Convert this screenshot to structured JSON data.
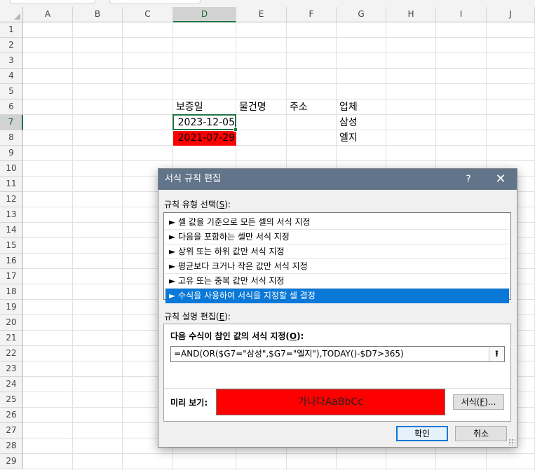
{
  "sheet": {
    "columns": [
      "A",
      "B",
      "C",
      "D",
      "E",
      "F",
      "G",
      "H",
      "I",
      "J"
    ],
    "rows": [
      "1",
      "2",
      "3",
      "4",
      "5",
      "6",
      "7",
      "8",
      "9",
      "10",
      "11",
      "12",
      "13",
      "14",
      "15",
      "16",
      "17",
      "18",
      "19",
      "20",
      "21",
      "22",
      "23",
      "24",
      "25",
      "26",
      "27",
      "28",
      "29"
    ],
    "selected_column": "D",
    "selected_row": "7",
    "cells": {
      "d6": "보증일",
      "e6": "물건명",
      "f6": "주소",
      "g6": "업체",
      "d7": "2023-12-05",
      "g7": "삼성",
      "d8": "2021-07-29",
      "g8": "엘지"
    },
    "highlight_color": "#ff0000",
    "accent_color": "#217346"
  },
  "dialog": {
    "title": "서식 규칙 편집",
    "help_glyph": "?",
    "close_glyph": "✕",
    "rule_type_label": "규칙 유형 선택(",
    "rule_type_key": "S",
    "rule_type_suffix": "):",
    "rule_types": [
      "► 셀 값을 기준으로 모든 셀의 서식 지정",
      "► 다음을 포함하는 셀만 서식 지정",
      "► 상위 또는 하위 값만 서식 지정",
      "► 평균보다 크거나 작은 값만 서식 지정",
      "► 고유 또는 중복 값만 서식 지정",
      "► 수식을 사용하여 서식을 지정할 셀 결정"
    ],
    "selected_rule_index": 5,
    "desc_label": "규칙 설명 편집(",
    "desc_key": "E",
    "desc_suffix": "):",
    "formula_label": "다음 수식이 참인 값의 서식 지정(",
    "formula_key": "O",
    "formula_suffix": "):",
    "formula_value": "=AND(OR($G7=\"삼성\",$G7=\"엘지\"),TODAY()-$D7>365)",
    "collapse_glyph": "⭱",
    "preview_label": "미리 보기:",
    "preview_text": "가나다AaBbCc",
    "preview_color": "#ff0000",
    "format_button_prefix": "서식(",
    "format_button_key": "F",
    "format_button_suffix": ")...",
    "ok_label": "확인",
    "cancel_label": "취소",
    "titlebar_color": "#62748a",
    "selection_color": "#0a78d7"
  }
}
